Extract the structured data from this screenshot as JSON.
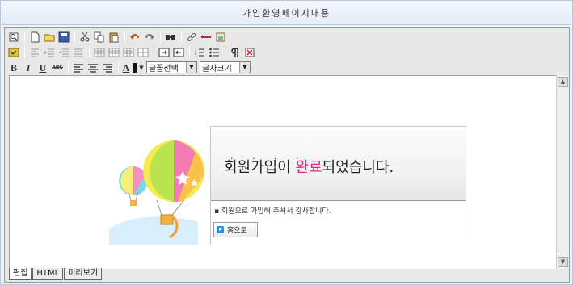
{
  "page": {
    "title": "가입환영페이지내용"
  },
  "toolbar": {
    "row1_icons": [
      "source-icon",
      "new-document-icon",
      "open-folder-icon",
      "save-icon",
      "cut-icon",
      "copy-icon",
      "paste-icon",
      "undo-icon",
      "redo-icon",
      "find-icon",
      "link-icon",
      "horizontal-rule-icon",
      "image-icon"
    ],
    "row2_icons": [
      "spellcheck-icon",
      "align-icon",
      "indent-icon",
      "outdent-icon",
      "table-icon",
      "table-row-icon",
      "table-col-icon",
      "table-cell-icon",
      "insert-row-icon",
      "delete-row-icon",
      "ordered-list-icon",
      "unordered-list-icon",
      "paragraph-mark-icon",
      "remove-format-icon"
    ],
    "bold": "B",
    "italic": "I",
    "underline": "U",
    "strike": "ABC",
    "font_color": "A",
    "font_select": "글꼴선택",
    "size_select": "글자크기"
  },
  "content": {
    "headline_pre": "회원가입이 ",
    "headline_highlight": "완료",
    "headline_post": "되었습니다.",
    "dots": "· · · ·",
    "message": "▪ 회원으로 가입해 주셔서 감사합니다.",
    "home_button": "홈으로",
    "highlight_color": "#e2287b"
  },
  "tabs": [
    "편집",
    "HTML",
    "미리보기"
  ]
}
